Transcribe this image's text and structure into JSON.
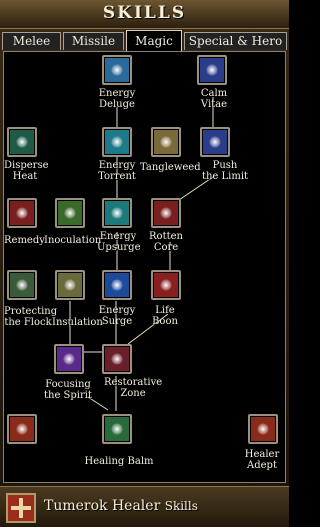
{
  "window": {
    "title": "SKILLS"
  },
  "tabs": [
    {
      "label": "Melee"
    },
    {
      "label": "Missile"
    },
    {
      "label": "Magic",
      "active": true
    },
    {
      "label": "Special & Hero"
    }
  ],
  "skills": [
    {
      "id": "energy-deluge",
      "label": "Energy\nDeluge",
      "color": "#2a6a9a"
    },
    {
      "id": "calm-vitae",
      "label": "Calm\nVitae",
      "color": "#2a3d8a"
    },
    {
      "id": "disperse-heat",
      "label": "Disperse\nHeat",
      "color": "#1f5a46"
    },
    {
      "id": "energy-torrent",
      "label": "Energy\nTorrent",
      "color": "#1d7a8a"
    },
    {
      "id": "tangleweed",
      "label": "Tangleweed",
      "color": "#7a6a3a"
    },
    {
      "id": "push-the-limit",
      "label": "Push\nthe Limit",
      "color": "#2a3d8a"
    },
    {
      "id": "remedy",
      "label": "Remedy",
      "color": "#7a1f1f"
    },
    {
      "id": "inoculation",
      "label": "Inoculation",
      "color": "#3a6a2a"
    },
    {
      "id": "energy-upsurge",
      "label": "Energy\nUpsurge",
      "color": "#1d7a7a"
    },
    {
      "id": "rotten-core",
      "label": "Rotten\nCore",
      "color": "#7a1f1f"
    },
    {
      "id": "protecting-the-flock",
      "label": "Protecting\nthe Flock",
      "color": "#3a5a3a"
    },
    {
      "id": "insulation",
      "label": "Insulation",
      "color": "#6a6a3a"
    },
    {
      "id": "energy-surge",
      "label": "Energy\nSurge",
      "color": "#1d4a9a"
    },
    {
      "id": "life-boon",
      "label": "Life\nBoon",
      "color": "#8a1f1f"
    },
    {
      "id": "focusing-the-spirit",
      "label": "Focusing\nthe Spirit",
      "color": "#5a2a8a"
    },
    {
      "id": "restorative-zone",
      "label": "Restorative\nZone",
      "color": "#6a1f2a"
    },
    {
      "id": "unnamed-red-skill",
      "label": "",
      "color": "#8a2a1a"
    },
    {
      "id": "healing-balm",
      "label": "Healing Balm",
      "color": "#2a6a3a"
    },
    {
      "id": "healer-adept",
      "label": "Healer\nAdept",
      "color": "#8a2a1a"
    }
  ],
  "class_bar": {
    "name": "Tumerok Healer",
    "suffix": "Skills",
    "icon": "healer-cross-icon"
  }
}
